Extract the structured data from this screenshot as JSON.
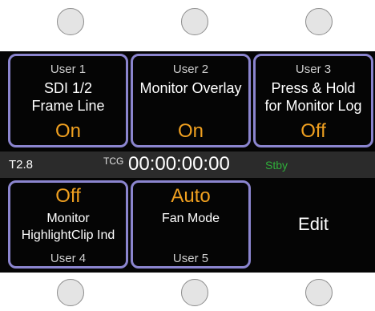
{
  "tiles": {
    "user1": {
      "name": "User 1",
      "line1": "SDI 1/2",
      "line2": "Frame Line",
      "value": "On"
    },
    "user2": {
      "name": "User 2",
      "line1": "Monitor Overlay",
      "value": "On"
    },
    "user3": {
      "name": "User 3",
      "line1": "Press & Hold",
      "line2": "for Monitor Log",
      "value": "Off"
    },
    "user4": {
      "name": "User 4",
      "line1": "Monitor",
      "line2": "HighlightClip Ind",
      "value": "Off"
    },
    "user5": {
      "name": "User 5",
      "line1": "Fan Mode",
      "value": "Auto"
    },
    "edit": {
      "label": "Edit"
    }
  },
  "status": {
    "iris": "T2.8",
    "tc_label": "TCG",
    "timecode": "00:00:00:00",
    "rec_state": "Stby"
  },
  "colors": {
    "value": "#f0a020",
    "frame": "#8b85cf",
    "standby": "#2fae3a",
    "status_bar": "#2b2b2b"
  }
}
